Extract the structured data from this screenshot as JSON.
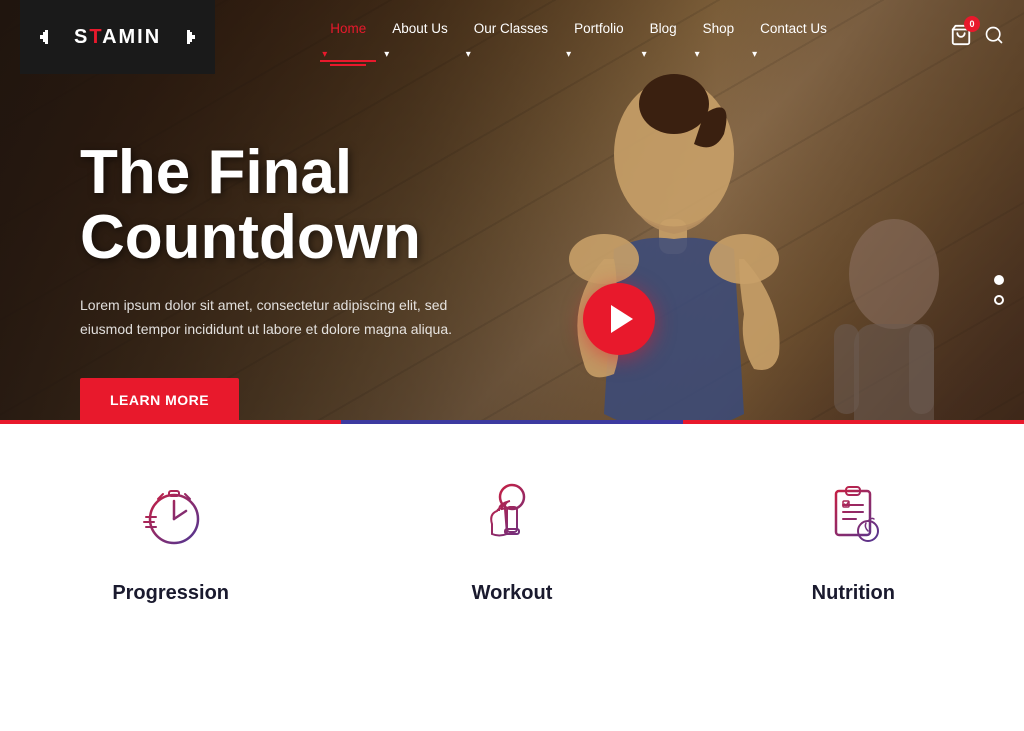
{
  "logo": {
    "name": "STAMIN",
    "icon_left": "⊣",
    "icon_right": "⊢"
  },
  "nav": {
    "items": [
      {
        "label": "Home",
        "active": true,
        "has_dropdown": true
      },
      {
        "label": "About Us",
        "active": false,
        "has_dropdown": true
      },
      {
        "label": "Our Classes",
        "active": false,
        "has_dropdown": true
      },
      {
        "label": "Portfolio",
        "active": false,
        "has_dropdown": true
      },
      {
        "label": "Blog",
        "active": false,
        "has_dropdown": true
      },
      {
        "label": "Shop",
        "active": false,
        "has_dropdown": true
      },
      {
        "label": "Contact Us",
        "active": false,
        "has_dropdown": true
      }
    ],
    "cart_count": "0",
    "search_placeholder": "Search..."
  },
  "hero": {
    "title": "The Final Countdown",
    "subtitle": "Lorem ipsum dolor sit amet, consectetur adipiscing elit, sed eiusmod tempor incididunt ut labore et dolore magna aliqua.",
    "cta_label": "Learn More",
    "slider_dots": [
      {
        "active": true
      },
      {
        "active": false
      }
    ]
  },
  "features": [
    {
      "id": "progression",
      "title": "Progression",
      "icon": "stopwatch",
      "border_color": "#e8192c"
    },
    {
      "id": "workout",
      "title": "Workout",
      "icon": "dumbbell",
      "border_color": "#3d3aa0"
    },
    {
      "id": "nutrition",
      "title": "Nutrition",
      "icon": "clipboard-food",
      "border_color": "#e8192c"
    }
  ]
}
